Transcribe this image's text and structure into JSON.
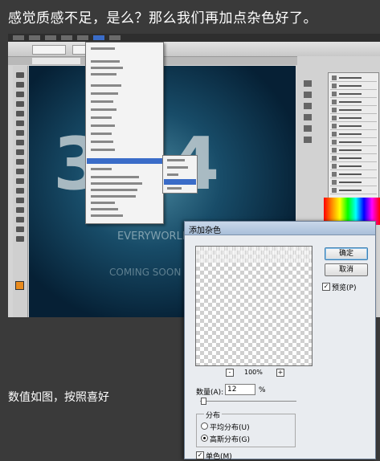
{
  "captions": {
    "top": "感觉质感不足，是么？那么我们再加点杂色好了。",
    "bottom": "数值如图，按照喜好"
  },
  "canvas": {
    "number_text": "3 14",
    "sub_text": "EVERYWORLD",
    "bottom_text": "COMING SOON"
  },
  "dialog": {
    "title": "添加杂色",
    "ok_label": "确定",
    "cancel_label": "取消",
    "preview_label": "预览(P)",
    "preview_checked": "✓",
    "zoom_out": "-",
    "zoom_in": "+",
    "zoom_level": "100%",
    "amount_label": "数量(A):",
    "amount_value": "12",
    "amount_unit": "%",
    "amount_fraction": 0.03,
    "distribution_title": "分布",
    "uniform_label": "平均分布(U)",
    "gaussian_label": "高斯分布(G)",
    "selected_distribution": "gaussian",
    "monochromatic_label": "单色(M)",
    "monochromatic_checked": "✓"
  },
  "colors": {
    "page_bg": "#3a3a3a",
    "menu_highlight": "#3a6cc8",
    "foreground_swatch": "#e88a1c"
  }
}
